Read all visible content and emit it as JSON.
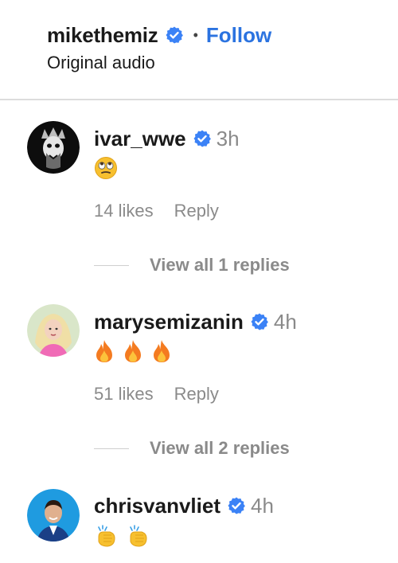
{
  "header": {
    "username": "mikethemiz",
    "separator": "•",
    "follow_label": "Follow",
    "audio_label": "Original audio"
  },
  "comments": [
    {
      "username": "ivar_wwe",
      "time": "3h",
      "emoji": [
        "eye-roll-emoji"
      ],
      "likes": "14 likes",
      "reply_label": "Reply",
      "view_replies": "View all 1 replies"
    },
    {
      "username": "marysemizanin",
      "time": "4h",
      "emoji": [
        "fire-emoji",
        "fire-emoji",
        "fire-emoji"
      ],
      "likes": "51 likes",
      "reply_label": "Reply",
      "view_replies": "View all 2 replies"
    },
    {
      "username": "chrisvanvliet",
      "time": "4h",
      "emoji": [
        "clapping-hands-emoji",
        "clapping-hands-emoji"
      ]
    }
  ],
  "colors": {
    "accent_blue": "#2b73e0",
    "verified_blue": "#3b82f6",
    "muted_text": "#8a8a8a",
    "divider": "#dcdcdc"
  }
}
